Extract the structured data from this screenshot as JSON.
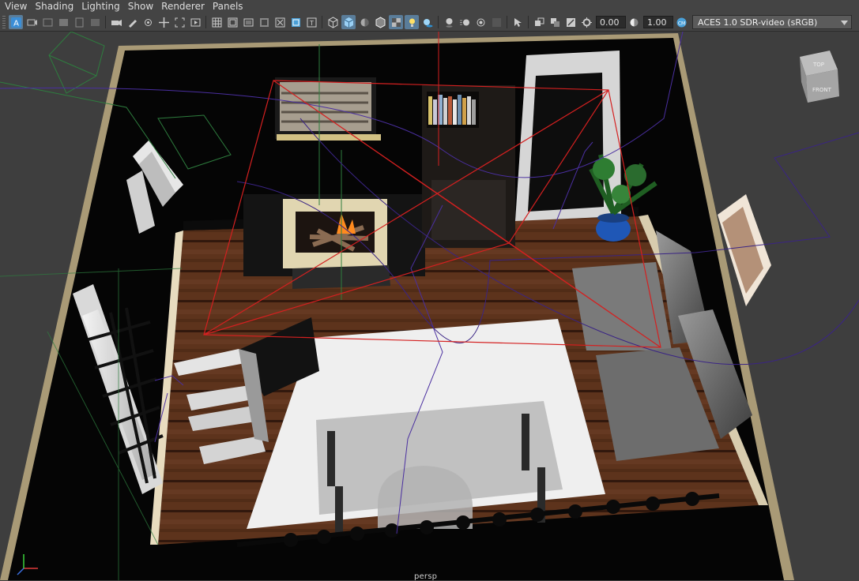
{
  "menu": [
    "View",
    "Shading",
    "Lighting",
    "Show",
    "Renderer",
    "Panels"
  ],
  "toolbar": {
    "exposure": "0.00",
    "gamma": "1.00",
    "color_space": "ACES 1.0 SDR-video (sRGB)"
  },
  "view_cube": {
    "top": "TOP",
    "front": "FRONT"
  },
  "viewport": {
    "camera": "persp"
  },
  "colors": {
    "ui_bg": "#444444",
    "viewport_bg": "#3e3e3e",
    "active_blue": "#5a7d9a",
    "camera_frustum": "#d42020"
  }
}
